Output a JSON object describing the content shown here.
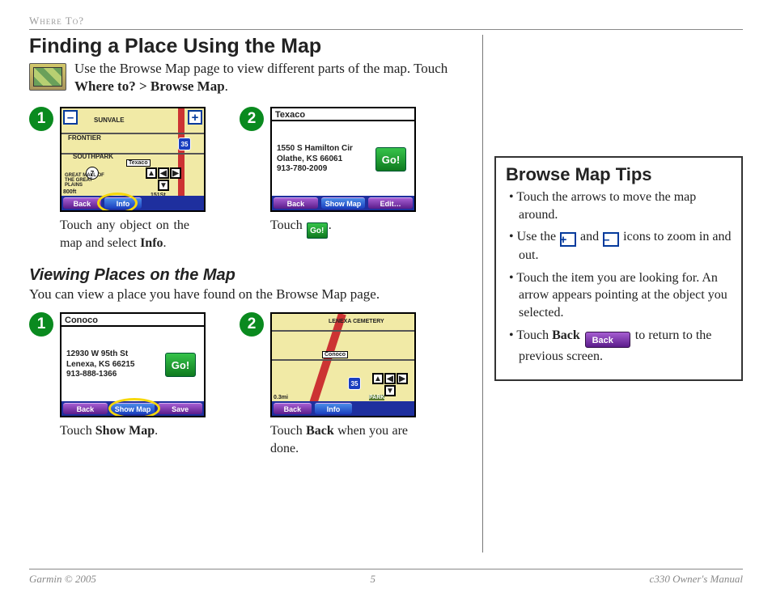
{
  "header": {
    "breadcrumb": "Where To?"
  },
  "main": {
    "title": "Finding a Place Using the Map",
    "intro_a": "Use the Browse Map page to view different parts of the map. Touch ",
    "intro_b_bold": "Where to? > Browse Map",
    "intro_c": ".",
    "subhead": "Viewing Places on the Map",
    "subtext": "You can view a place you have found on the Browse Map page."
  },
  "steps_a": {
    "s1": {
      "num": "1",
      "map": {
        "minus": "–",
        "plus": "+",
        "l_sunvale": "SUNVALE",
        "l_frontier": "FRONTIER",
        "l_southpark": "SOUTHPARK",
        "l_mall": "GREAT MALL OF\nTHE GREAT\nPLAINS",
        "l_texaco": "Texaco",
        "l_800": "800ft",
        "l_151": "151St",
        "shield_35": "35",
        "shield_7": "7",
        "btn_back": "Back",
        "btn_info": "Info"
      },
      "cap_a": "Touch any object on the map and select ",
      "cap_b_bold": "Info",
      "cap_c": "."
    },
    "s2": {
      "num": "2",
      "panel": {
        "title": "Texaco",
        "addr": "1550 S Hamilton Cir\nOlathe, KS 66061\n913-780-2009",
        "go": "Go!",
        "btn_back": "Back",
        "btn_showmap": "Show Map",
        "btn_edit": "Edit…"
      },
      "cap_a": "Touch ",
      "cap_go": "Go!",
      "cap_b": "."
    }
  },
  "steps_b": {
    "s1": {
      "num": "1",
      "panel": {
        "title": "Conoco",
        "addr": "12930 W 95th St\nLenexa, KS 66215\n913-888-1366",
        "go": "Go!",
        "btn_back": "Back",
        "btn_showmap": "Show Map",
        "btn_save": "Save"
      },
      "cap_a": "Touch ",
      "cap_b_bold": "Show Map",
      "cap_c": "."
    },
    "s2": {
      "num": "2",
      "map": {
        "l_cemetery": "LENEXA CEMETERY",
        "l_conoco": "Conoco",
        "l_park": "PARK",
        "l_03": "0.3mi",
        "shield_35": "35",
        "btn_back": "Back",
        "btn_info": "Info"
      },
      "cap_a": "Touch ",
      "cap_b_bold": "Back",
      "cap_c": " when you are done."
    }
  },
  "tips": {
    "title": "Browse Map Tips",
    "t1": "Touch the arrows to move the map around.",
    "t2a": "Use the ",
    "t2_plus": "+",
    "t2b": " and ",
    "t2_minus": "–",
    "t2c": " icons to zoom in and out.",
    "t3": "Touch the item you are looking for. An arrow appears pointing at the object you selected.",
    "t4a": "Touch ",
    "t4_bold": "Back",
    "t4_chip": "Back",
    "t4b": " to return to the previous screen."
  },
  "footer": {
    "left": "Garmin © 2005",
    "center": "5",
    "right": "c330 Owner's Manual"
  }
}
